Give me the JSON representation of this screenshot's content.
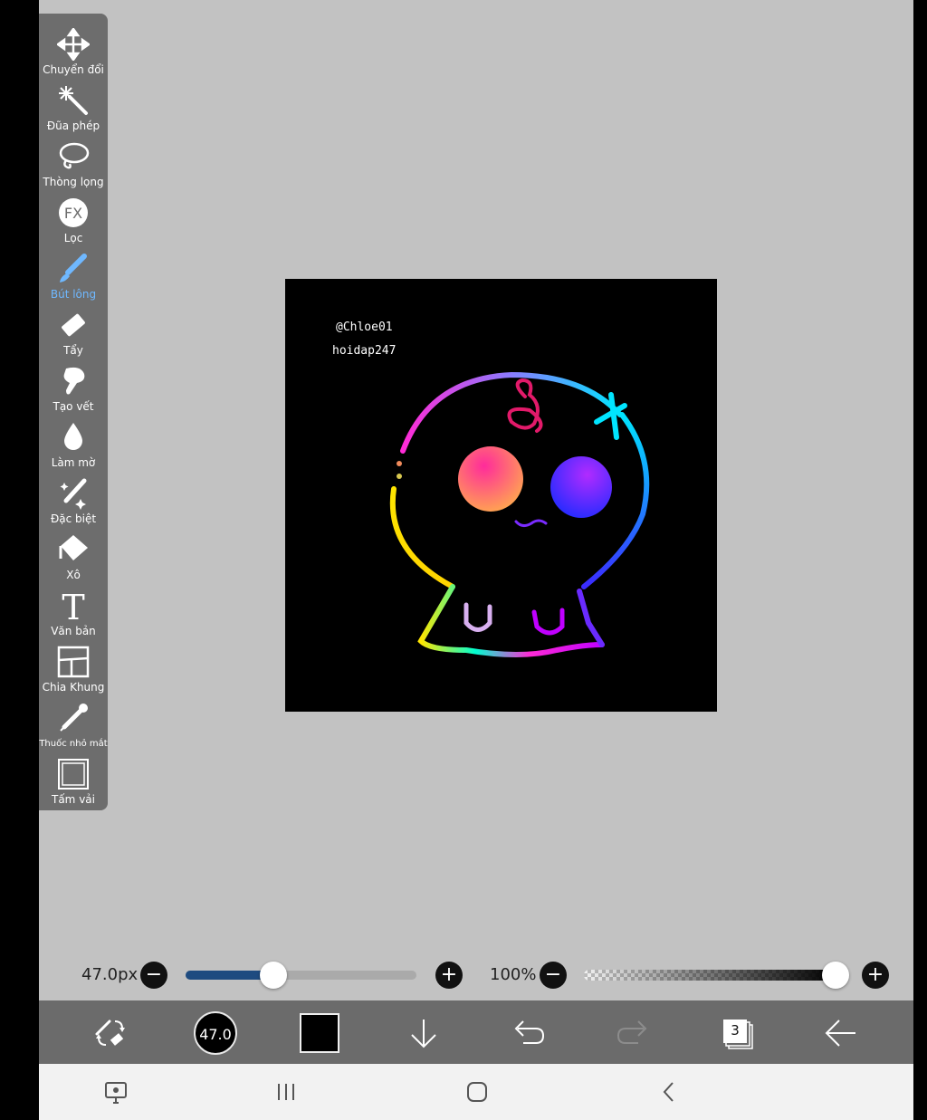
{
  "tools": [
    {
      "label": "Chuyển đổi",
      "icon": "move-icon",
      "active": false
    },
    {
      "label": "Đũa phép",
      "icon": "magic-wand-icon",
      "active": false
    },
    {
      "label": "Thòng lọng",
      "icon": "lasso-icon",
      "active": false
    },
    {
      "label": "Lọc",
      "icon": "fx-filter-icon",
      "active": false
    },
    {
      "label": "Bút lông",
      "icon": "brush-icon",
      "active": true
    },
    {
      "label": "Tẩy",
      "icon": "eraser-icon",
      "active": false
    },
    {
      "label": "Tạo vết",
      "icon": "smudge-icon",
      "active": false
    },
    {
      "label": "Làm mờ",
      "icon": "blur-drop-icon",
      "active": false
    },
    {
      "label": "Đặc biệt",
      "icon": "special-wand-icon",
      "active": false
    },
    {
      "label": "Xô",
      "icon": "bucket-icon",
      "active": false
    },
    {
      "label": "Văn bản",
      "icon": "text-icon",
      "active": false
    },
    {
      "label": "Chia Khung",
      "icon": "frame-divider-icon",
      "active": false
    },
    {
      "label": "Thuốc nhỏ mắt",
      "icon": "eyedropper-icon",
      "active": false
    },
    {
      "label": "Tấm vải",
      "icon": "canvas-icon",
      "active": false
    }
  ],
  "canvas": {
    "signature_line1": "@Chloe01",
    "signature_line2": "hoidap247"
  },
  "brush_size": {
    "label": "47.0px",
    "value": 47.0,
    "slider_fraction": 0.38
  },
  "opacity": {
    "label": "100%",
    "value": 100,
    "slider_fraction": 1.0
  },
  "bottom_bar": {
    "brush_size_badge": "47.0",
    "color": "#000000",
    "layer_count": "3"
  },
  "colors": {
    "app_background": "#c2c2c2",
    "toolbar": "#6d6d6d",
    "active_tool": "#6fb8ff",
    "size_slider_fill": "#1e4b80"
  }
}
